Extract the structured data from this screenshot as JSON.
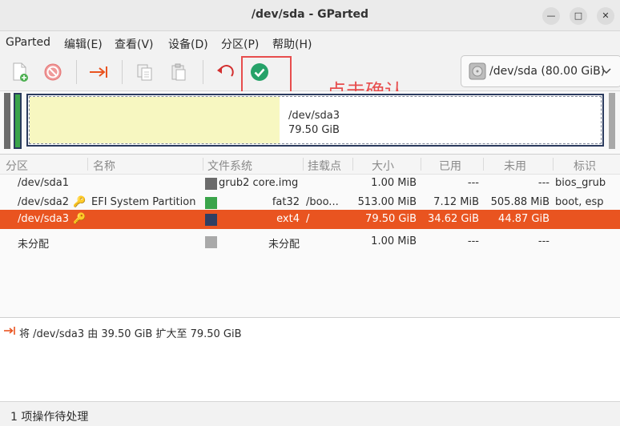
{
  "window": {
    "title": "/dev/sda - GParted"
  },
  "menubar": {
    "items": [
      "GParted",
      "编辑(E)",
      "查看(V)",
      "设备(D)",
      "分区(P)",
      "帮助(H)"
    ]
  },
  "toolbar": {
    "device_label": "/dev/sda (80.00 GiB)"
  },
  "annotation": {
    "text": "点击确认"
  },
  "diskmap": {
    "partition": "/dev/sda3",
    "size": "79.50 GiB",
    "used_fraction": 0.435
  },
  "table": {
    "headers": [
      "分区",
      "名称",
      "文件系统",
      "挂载点",
      "大小",
      "已用",
      "未用",
      "标识"
    ],
    "rows": [
      {
        "partition": "/dev/sda1",
        "name": "",
        "fs": "grub2 core.img",
        "fs_color": "#6b6b6b",
        "mount": "",
        "size": "1.00 MiB",
        "used": "---",
        "unused": "---",
        "flags": "bios_grub",
        "selected": false
      },
      {
        "partition": "/dev/sda2",
        "name": "EFI System Partition",
        "fs": "fat32",
        "fs_color": "#3aa44a",
        "mount": "/boo...",
        "size": "513.00 MiB",
        "used": "7.12 MiB",
        "unused": "505.88 MiB",
        "flags": "boot, esp",
        "selected": false
      },
      {
        "partition": "/dev/sda3",
        "name": "",
        "fs": "ext4",
        "fs_color": "#2f3f63",
        "mount": "/",
        "size": "79.50 GiB",
        "used": "34.62 GiB",
        "unused": "44.87 GiB",
        "flags": "",
        "selected": true
      },
      {
        "partition": "未分配",
        "name": "",
        "fs": "未分配",
        "fs_color": "#a9a9a9",
        "mount": "",
        "size": "1.00 MiB",
        "used": "---",
        "unused": "---",
        "flags": "",
        "selected": false
      }
    ]
  },
  "operations": {
    "items": [
      "将 /dev/sda3 由 39.50 GiB 扩大至 79.50 GiB"
    ]
  },
  "status": {
    "text": "1 项操作待处理"
  },
  "colors": {
    "accent": "#e95420",
    "annotation": "#e74d4d",
    "apply": "#26a269"
  }
}
